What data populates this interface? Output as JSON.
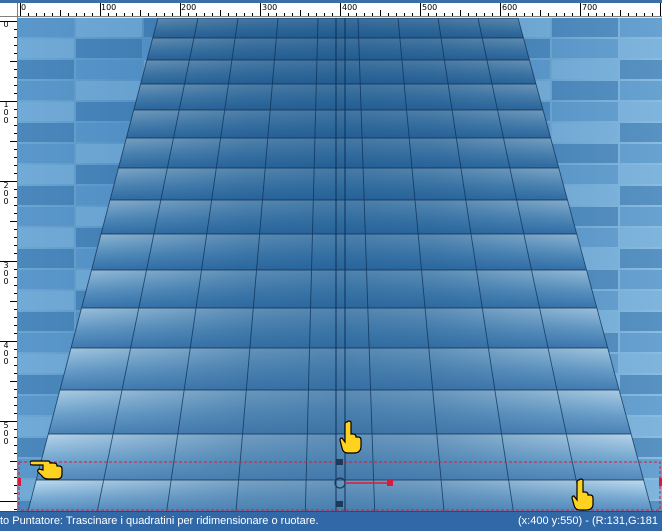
{
  "ruler": {
    "top_labels": [
      "0",
      "100",
      "200",
      "300",
      "400",
      "500",
      "600",
      "700"
    ],
    "left_labels": [
      "0",
      "100",
      "200",
      "300",
      "400",
      "500"
    ]
  },
  "status": {
    "message": "to Puntatore: Trascinare i quadratini per ridimensionare o ruotare.",
    "coords": "(x:400 y:550) - (R:131,G:181"
  },
  "canvas": {
    "image": "blue-tiled-floor-perspective",
    "selection_color": "#d81b3b",
    "tile_light": "#9ec8e6",
    "tile_dark": "#1f5d94"
  },
  "icons": [
    "pointing-hand-cursor",
    "pointing-hand-cursor",
    "pointing-hand-cursor",
    "rotate-handle-icon"
  ]
}
